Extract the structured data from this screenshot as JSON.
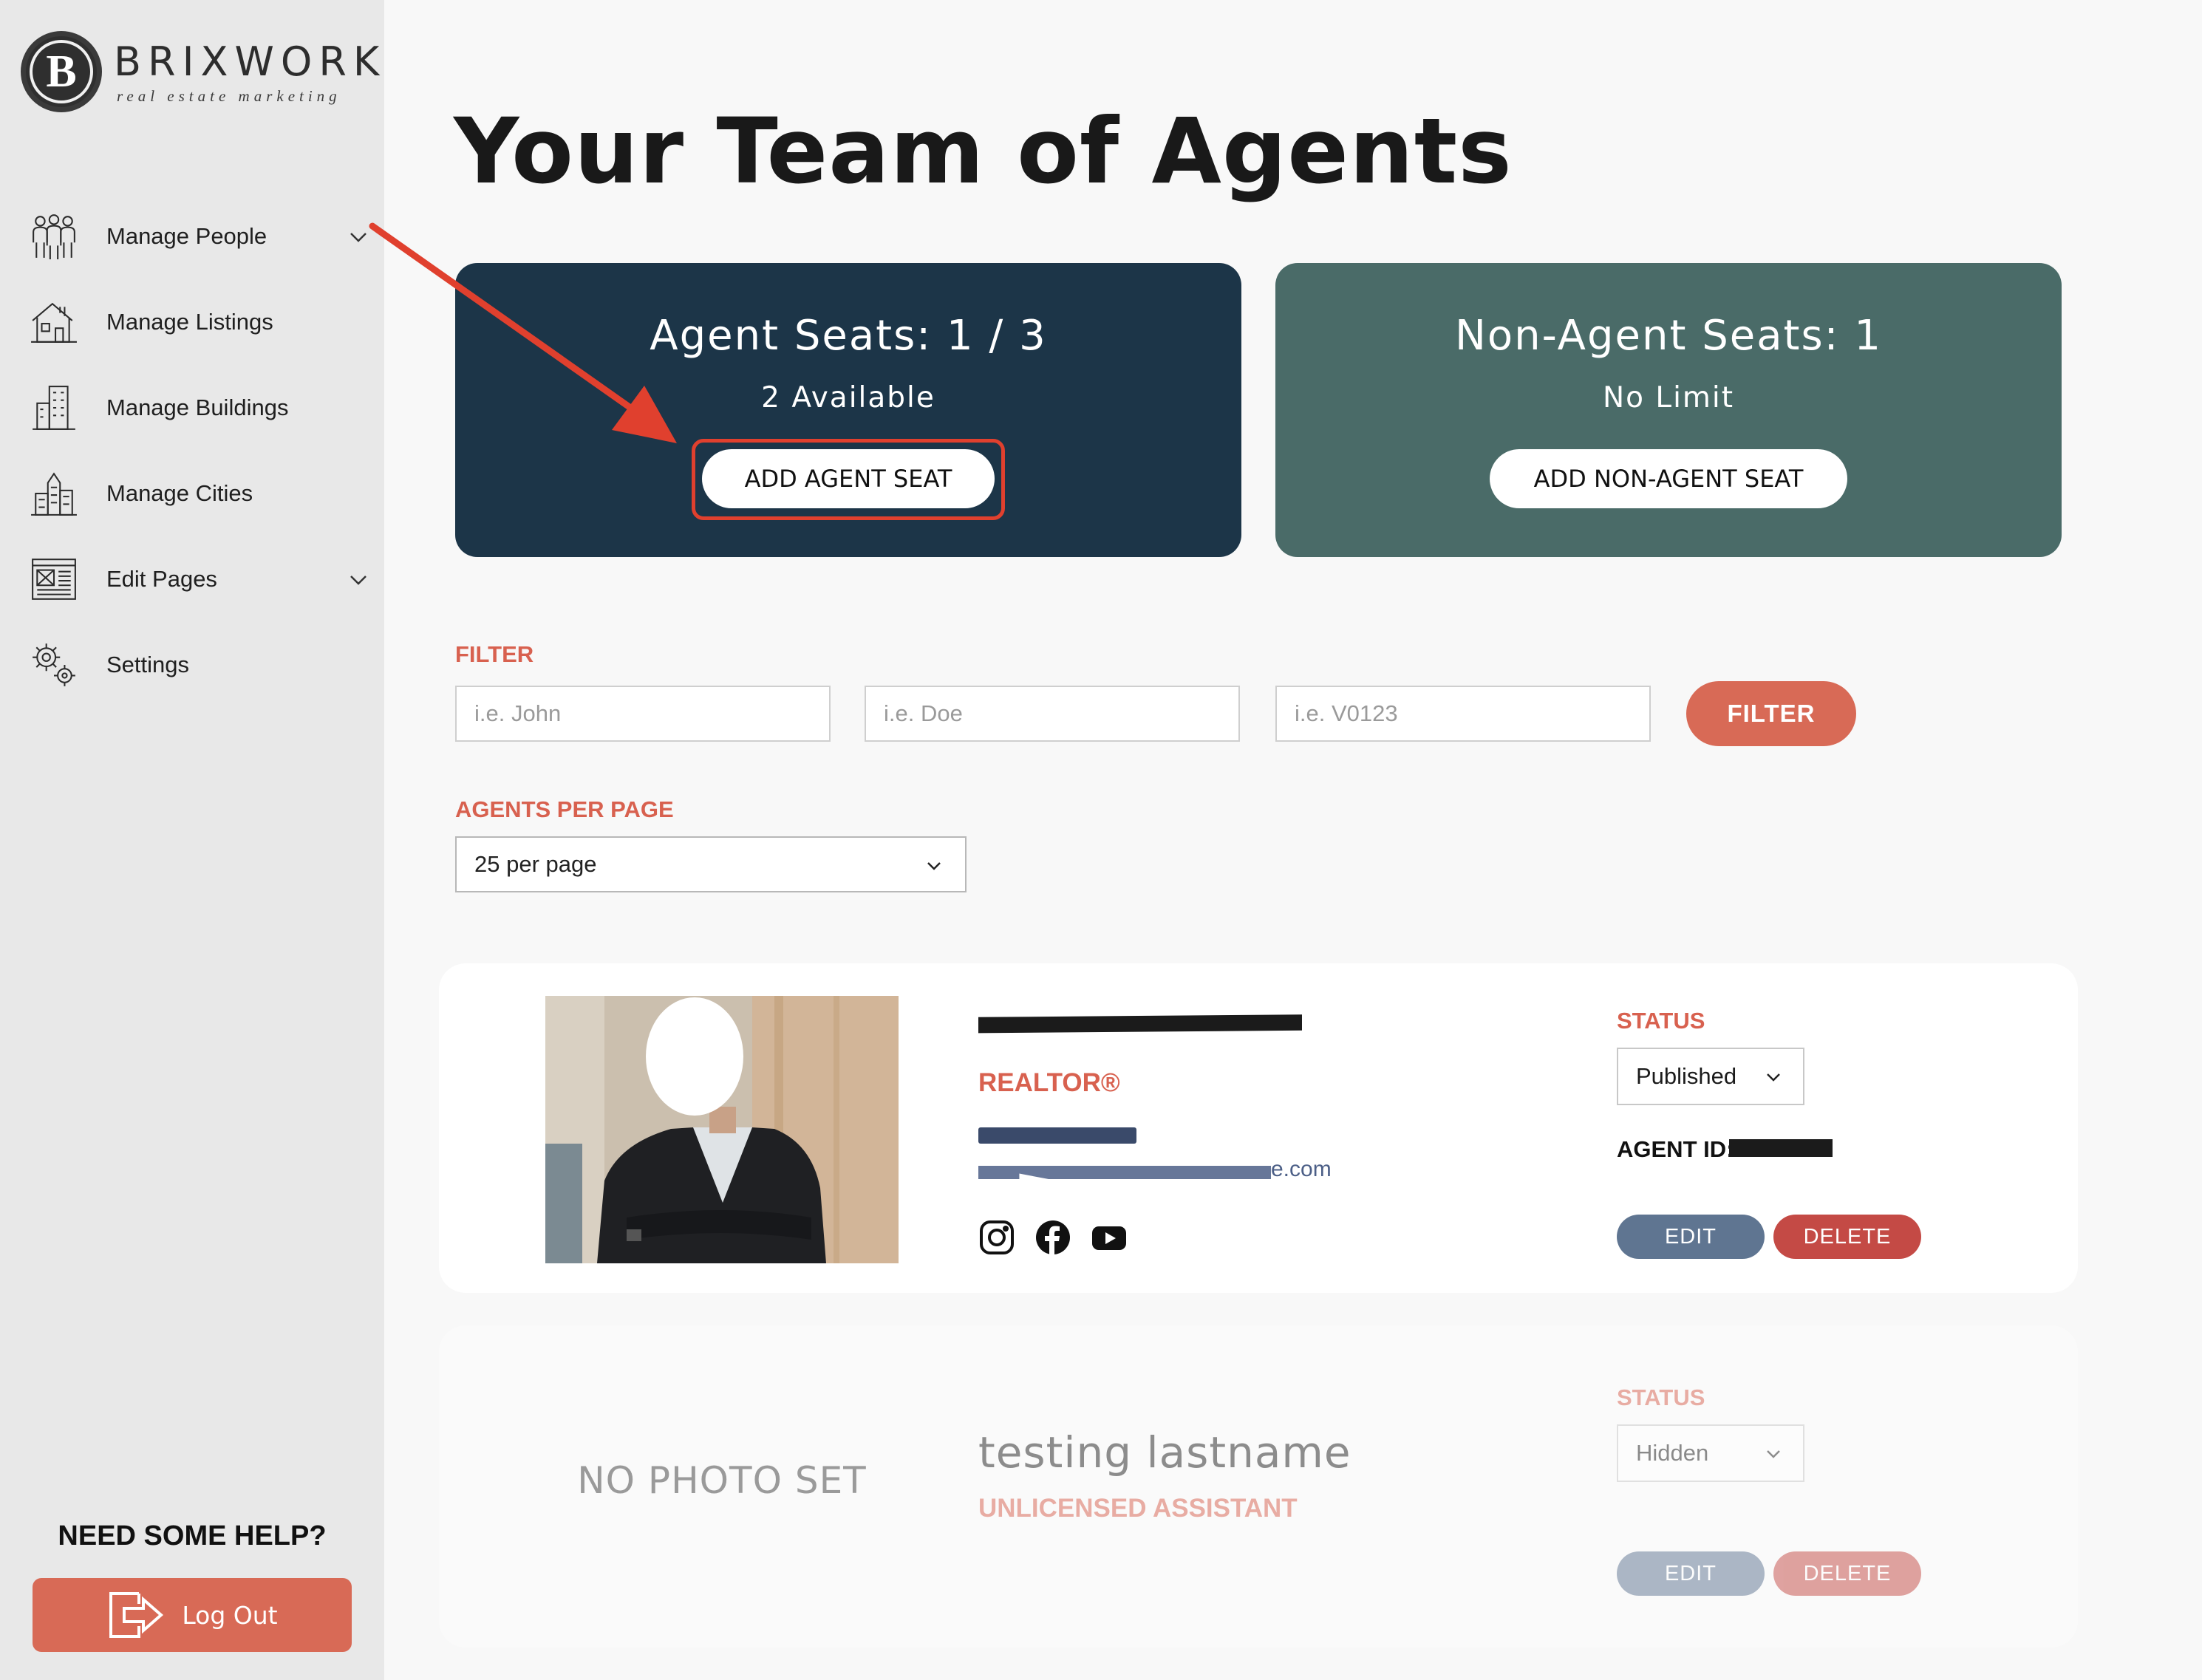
{
  "brand": {
    "initial": "B",
    "name": "BRIXWORK",
    "tagline": "real estate marketing"
  },
  "sidebar": {
    "items": [
      {
        "label": "Manage People",
        "icon": "people-icon",
        "has_chevron": true
      },
      {
        "label": "Manage Listings",
        "icon": "house-icon",
        "has_chevron": false
      },
      {
        "label": "Manage Buildings",
        "icon": "building-icon",
        "has_chevron": false
      },
      {
        "label": "Manage Cities",
        "icon": "city-icon",
        "has_chevron": false
      },
      {
        "label": "Edit Pages",
        "icon": "page-icon",
        "has_chevron": true
      },
      {
        "label": "Settings",
        "icon": "gears-icon",
        "has_chevron": false
      }
    ],
    "help_text": "NEED SOME HELP?",
    "logout_label": "Log Out"
  },
  "main": {
    "title": "Your Team of Agents",
    "agent_seats": {
      "title": "Agent Seats: 1 / 3",
      "subtitle": "2 Available",
      "button_label": "ADD AGENT SEAT"
    },
    "non_agent_seats": {
      "title": "Non-Agent Seats: 1",
      "subtitle": "No Limit",
      "button_label": "ADD NON-AGENT SEAT"
    },
    "filter": {
      "label": "FILTER",
      "first_name_placeholder": "i.e. John",
      "last_name_placeholder": "i.e. Doe",
      "id_placeholder": "i.e. V0123",
      "button_label": "FILTER"
    },
    "per_page": {
      "label": "AGENTS PER PAGE",
      "selected": "25 per page"
    },
    "agents": [
      {
        "name_redacted": true,
        "role": "REALTOR®",
        "email_visible_fragment": "e.com",
        "status_label": "STATUS",
        "status": "Published",
        "agent_id_label": "AGENT ID:",
        "edit_label": "EDIT",
        "delete_label": "DELETE",
        "socials": [
          "instagram-icon",
          "facebook-icon",
          "youtube-icon"
        ]
      },
      {
        "photo_placeholder": "NO PHOTO SET",
        "name": "testing lastname",
        "role": "UNLICENSED ASSISTANT",
        "status_label": "STATUS",
        "status": "Hidden",
        "edit_label": "EDIT",
        "delete_label": "DELETE"
      }
    ]
  },
  "colors": {
    "accent": "#d86a56",
    "navy_card": "#1c3548",
    "teal_card": "#4a6b68",
    "annotation": "#e0402e"
  }
}
